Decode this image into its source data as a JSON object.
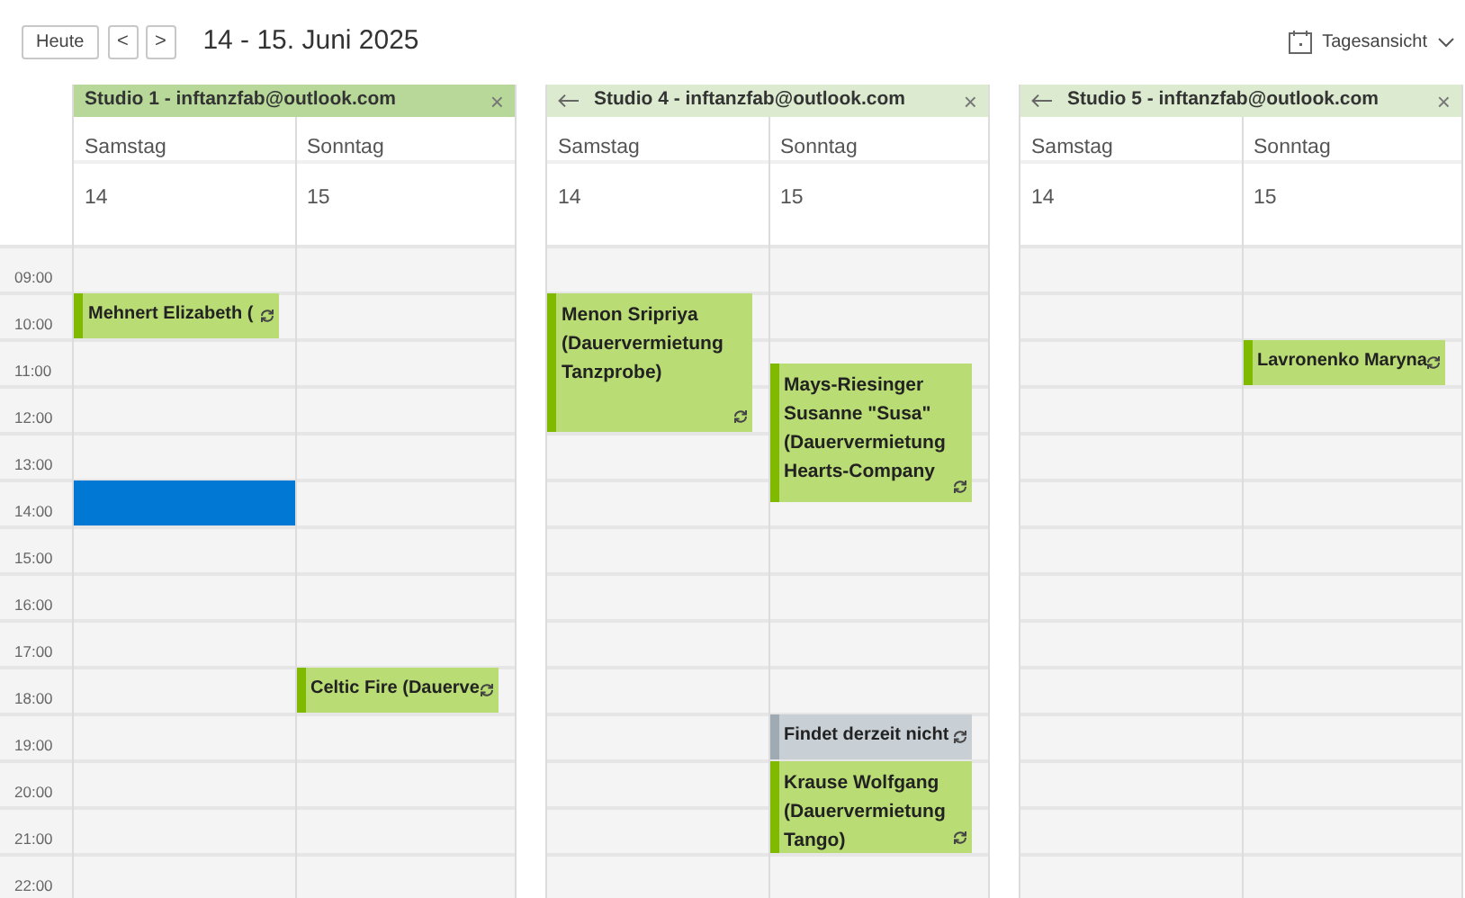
{
  "toolbar": {
    "today_button": "Heute",
    "prev_button": "<",
    "next_button": ">",
    "title": "14 - 15. Juni 2025",
    "view_menu": "Tagesansicht"
  },
  "hours": [
    "09:00",
    "10:00",
    "11:00",
    "12:00",
    "13:00",
    "14:00",
    "15:00",
    "16:00",
    "17:00",
    "18:00",
    "19:00",
    "20:00",
    "21:00",
    "22:00"
  ],
  "calendars": [
    {
      "title": "Studio 1 - inftanzfab@outlook.com",
      "selected": true,
      "back_arrow": false,
      "close": "×",
      "days": [
        {
          "weekday": "Samstag",
          "date": "14",
          "events": [
            {
              "kind": "appointment",
              "title": "Mehnert Elizabeth (",
              "recurring": true,
              "color": "#b9dc74"
            },
            {
              "kind": "selection",
              "color": "#0078d4"
            }
          ]
        },
        {
          "weekday": "Sonntag",
          "date": "15",
          "events": [
            {
              "kind": "appointment",
              "title": "Celtic Fire (Dauerve",
              "recurring": true,
              "color": "#b9dc74"
            }
          ]
        }
      ]
    },
    {
      "title": "Studio 4 - inftanzfab@outlook.com",
      "selected": false,
      "back_arrow": true,
      "close": "×",
      "days": [
        {
          "weekday": "Samstag",
          "date": "14",
          "events": [
            {
              "kind": "appointment",
              "title": "Menon Sripriya (Dauervermietung Tanzprobe)",
              "recurring": true,
              "color": "#b9dc74"
            }
          ]
        },
        {
          "weekday": "Sonntag",
          "date": "15",
          "events": [
            {
              "kind": "appointment",
              "title": "Mays-Riesinger Susanne \"Susa\" (Dauervermietung Hearts-Company",
              "recurring": true,
              "color": "#b9dc74"
            },
            {
              "kind": "appointment",
              "title": "Findet derzeit nicht",
              "recurring": true,
              "color": "#c8d0d6"
            },
            {
              "kind": "appointment",
              "title": "Krause Wolfgang (Dauervermietung Tango)",
              "recurring": true,
              "color": "#b9dc74"
            }
          ]
        }
      ]
    },
    {
      "title": "Studio 5 - inftanzfab@outlook.com",
      "selected": false,
      "back_arrow": true,
      "close": "×",
      "days": [
        {
          "weekday": "Samstag",
          "date": "14"
        },
        {
          "weekday": "Sonntag",
          "date": "15",
          "events": [
            {
              "kind": "appointment",
              "title": "Lavronenko Maryna",
              "recurring": true,
              "color": "#b9dc74"
            }
          ]
        }
      ]
    }
  ]
}
